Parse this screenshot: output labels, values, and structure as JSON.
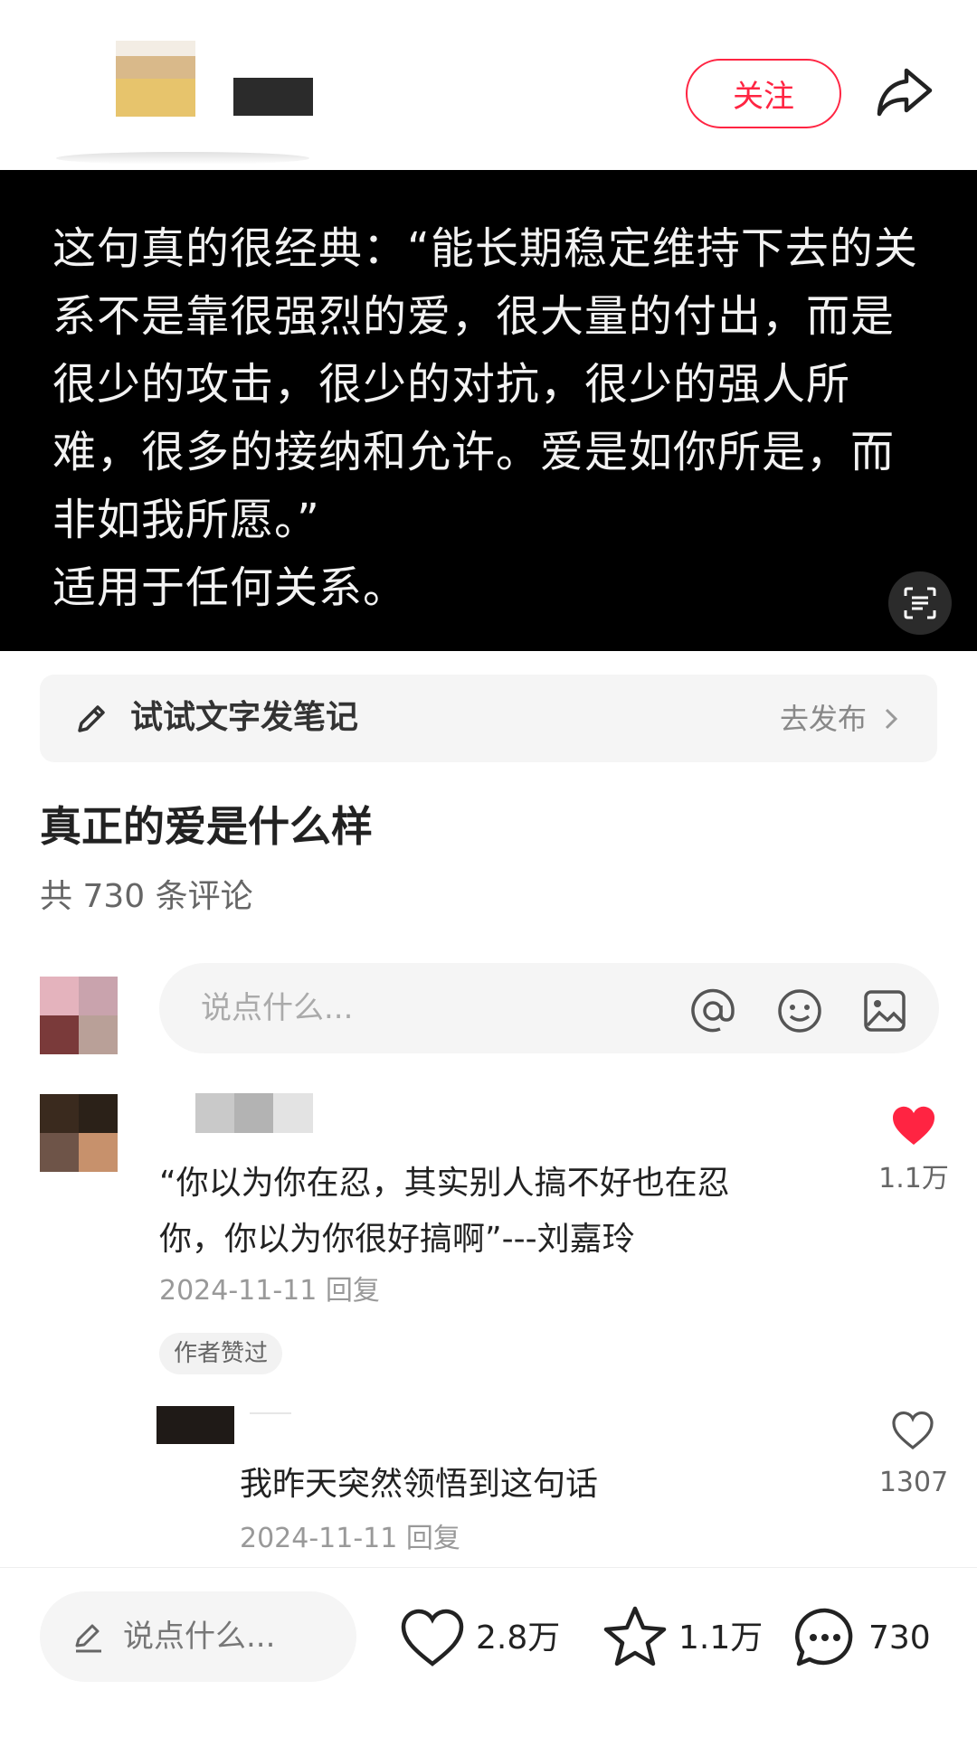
{
  "header": {
    "follow_label": "关注",
    "share_icon": "share-icon"
  },
  "post": {
    "quote_text": "这句真的很经典：“能长期稳定维持下去的关\n系不是靠很强烈的爱，很大量的付出，而是\n很少的攻击，很少的对抗，很少的强人所\n难，很多的接纳和允许。爱是如你所是，而\n非如我所愿。”\n适用于任何关系。",
    "scan_icon": "text-scan-icon"
  },
  "note_prompt": {
    "label": "试试文字发笔记",
    "action_label": "去发布"
  },
  "title": "真正的爱是什么样",
  "comment_count_text": "共 730 条评论",
  "comment_input": {
    "placeholder": "说点什么..."
  },
  "comments": [
    {
      "text": "“你以为你在忍，其实别人搞不好也在忍\n你，你以为你很好搞啊”---刘嘉玲",
      "date": "2024-11-11",
      "reply_label": "回复",
      "badge": "作者赞过",
      "likes": "1.1万",
      "liked": true,
      "like_color": "#ff2442"
    }
  ],
  "replies": [
    {
      "text": "我昨天突然领悟到这句话",
      "date": "2024-11-11",
      "reply_label": "回复",
      "likes": "1307",
      "liked": false
    }
  ],
  "bottom_bar": {
    "input_placeholder": "说点什么...",
    "likes": "2.8万",
    "stars": "1.1万",
    "comments": "730"
  },
  "colors": {
    "accent": "#ff2442",
    "post_background": "#000000"
  }
}
